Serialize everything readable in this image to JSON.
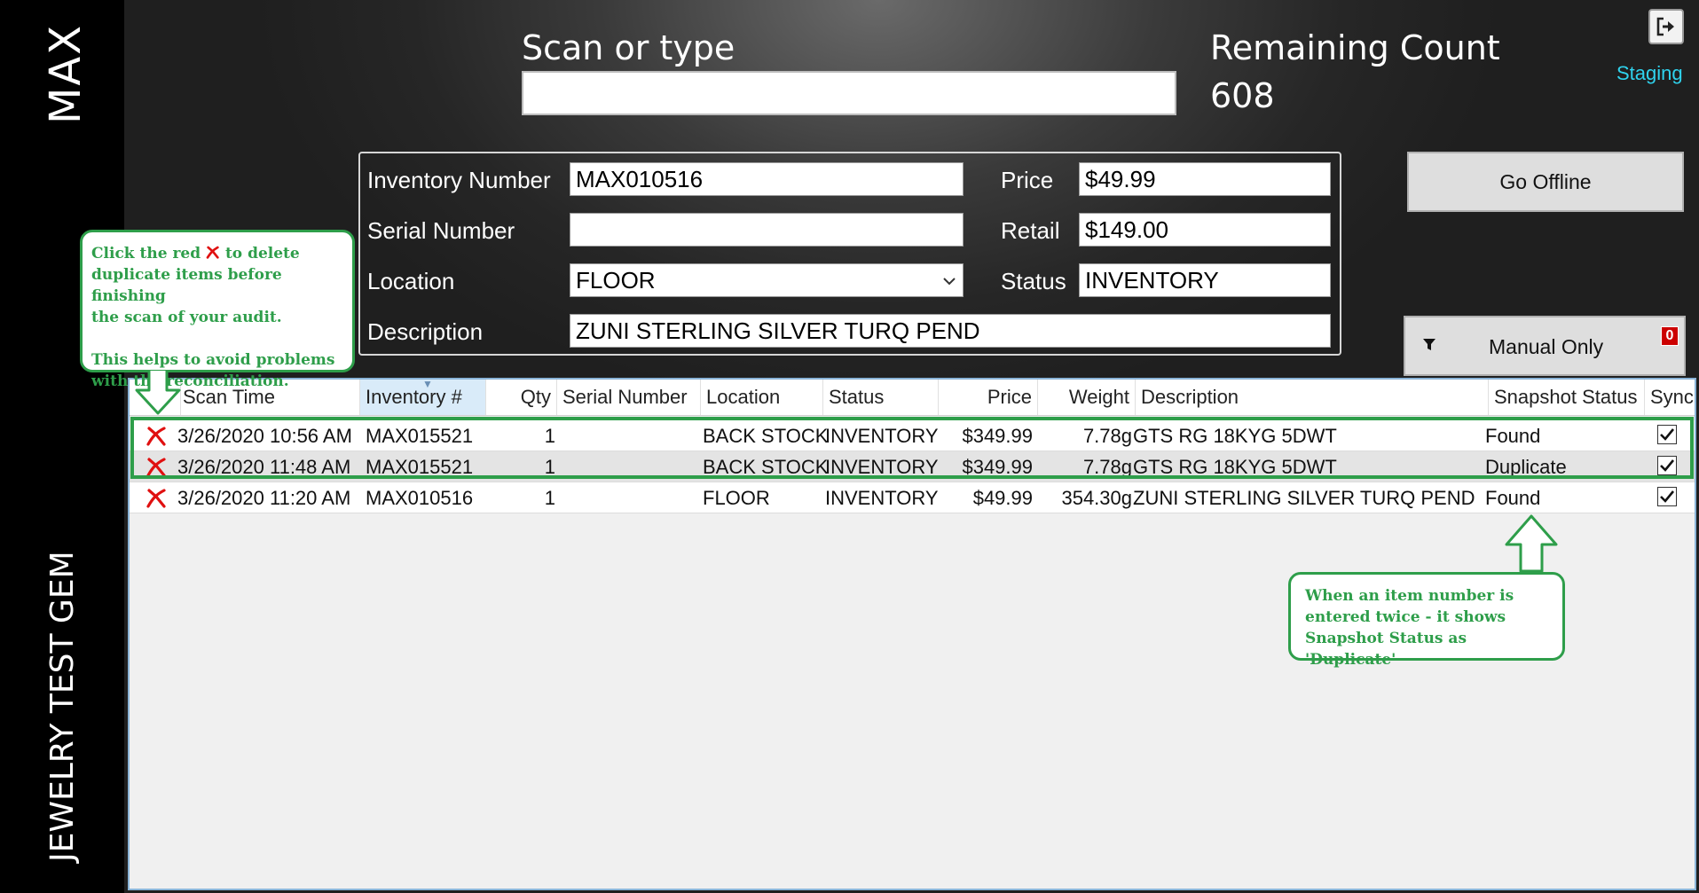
{
  "sidebar": {
    "app_name": "MAX",
    "store_name": "JEWELRY TEST GEM"
  },
  "header": {
    "scan_label": "Scan or type",
    "scan_value": "",
    "remaining_label": "Remaining Count",
    "remaining_value": "608",
    "exit_icon": "exit-icon",
    "staging_link": "Staging"
  },
  "detail": {
    "inventory_number_label": "Inventory Number",
    "inventory_number_value": "MAX010516",
    "serial_number_label": "Serial Number",
    "serial_number_value": "",
    "location_label": "Location",
    "location_value": "FLOOR",
    "description_label": "Description",
    "description_value": "ZUNI STERLING SILVER TURQ PEND",
    "price_label": "Price",
    "price_value": "$49.99",
    "retail_label": "Retail",
    "retail_value": "$149.00",
    "status_label": "Status",
    "status_value": "INVENTORY"
  },
  "actions": {
    "go_offline_label": "Go Offline",
    "manual_only_label": "Manual Only",
    "manual_only_count": "0"
  },
  "grid": {
    "columns": [
      "Scan Time",
      "Inventory #",
      "Qty",
      "Serial Number",
      "Location",
      "Status",
      "Price",
      "Weight",
      "Description",
      "Snapshot Status",
      "Sync"
    ],
    "sorted_column": "Inventory #",
    "rows": [
      {
        "scan_time": "3/26/2020 10:56 AM",
        "inventory": "MAX015521",
        "qty": "1",
        "serial": "",
        "location": "BACK STOCK",
        "status": "INVENTORY",
        "price": "$349.99",
        "weight": "7.78g",
        "description": "GTS RG 18KYG 5DWT",
        "snapshot": "Found",
        "sync": true
      },
      {
        "scan_time": "3/26/2020 11:48 AM",
        "inventory": "MAX015521",
        "qty": "1",
        "serial": "",
        "location": "BACK STOCK",
        "status": "INVENTORY",
        "price": "$349.99",
        "weight": "7.78g",
        "description": "GTS RG 18KYG 5DWT",
        "snapshot": "Duplicate",
        "sync": true
      },
      {
        "scan_time": "3/26/2020 11:20 AM",
        "inventory": "MAX010516",
        "qty": "1",
        "serial": "",
        "location": "FLOOR",
        "status": "INVENTORY",
        "price": "$49.99",
        "weight": "354.30g",
        "description": "ZUNI STERLING SILVER TURQ PEND",
        "snapshot": "Found",
        "sync": true
      }
    ]
  },
  "annotations": {
    "left_callout_line1": "Click the red",
    "left_callout_line1b": "to delete",
    "left_callout_line2": "duplicate items before finishing",
    "left_callout_line3": "the scan of your audit.",
    "left_callout_line4": "This helps to avoid problems",
    "left_callout_line5": "with the reconciliation.",
    "right_callout_line1": "When an item number is",
    "right_callout_line2": "entered twice - it shows",
    "right_callout_line3": "Snapshot Status as 'Duplicate'",
    "accent_color": "#2e9e4a",
    "delete_color": "#e01010"
  }
}
